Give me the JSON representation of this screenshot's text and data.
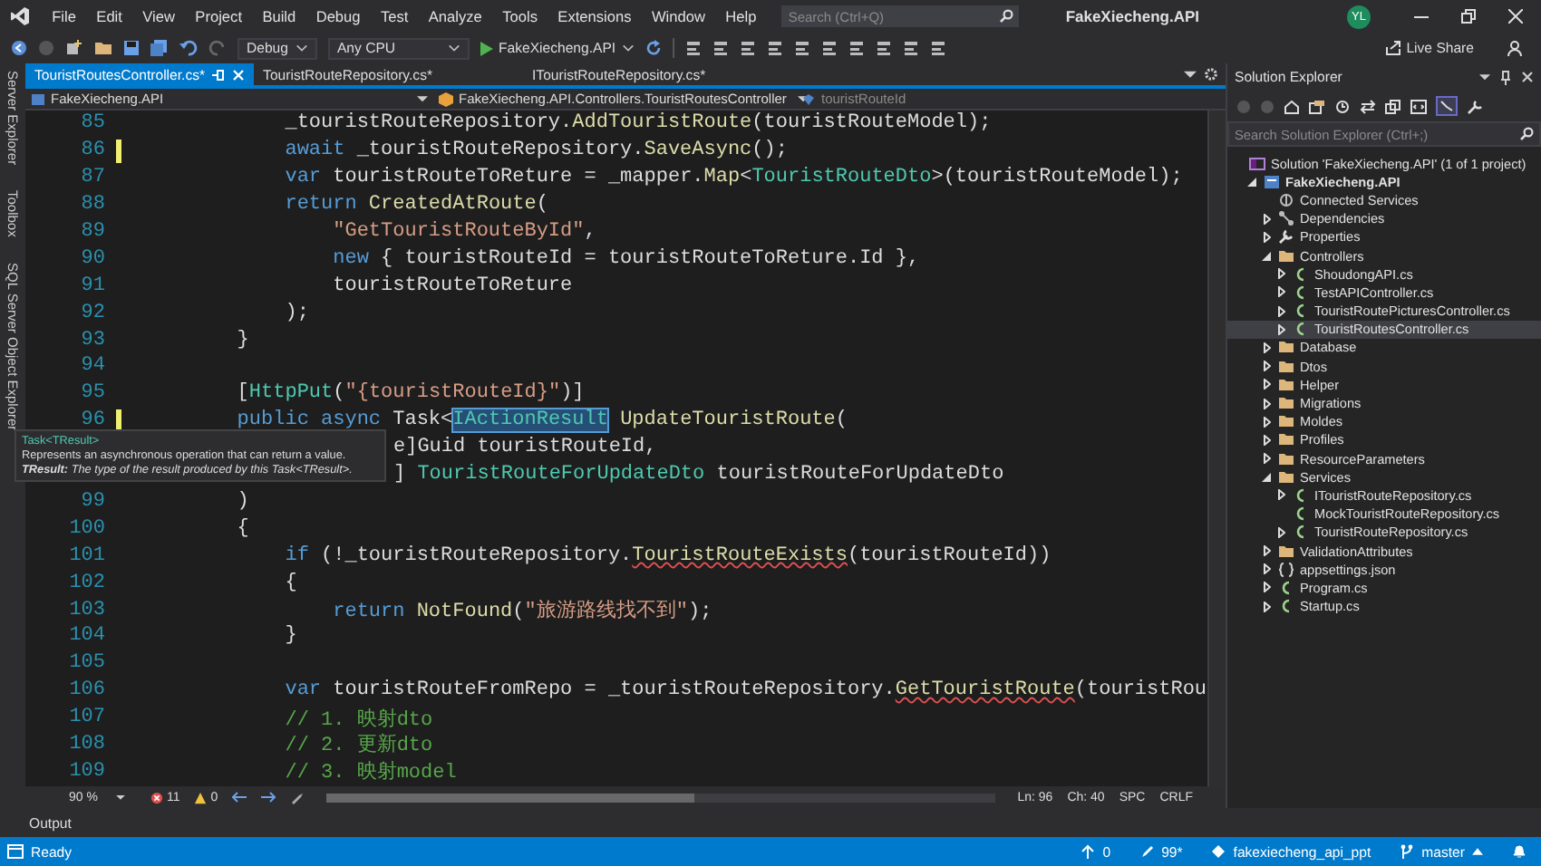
{
  "title_bar": {
    "menus": [
      "File",
      "Edit",
      "View",
      "Project",
      "Build",
      "Debug",
      "Test",
      "Analyze",
      "Tools",
      "Extensions",
      "Window",
      "Help"
    ],
    "search": {
      "placeholder": "Search (Ctrl+Q)"
    },
    "title": "FakeXiecheng.API",
    "avatar": "YL"
  },
  "toolbar": {
    "configuration": "Debug",
    "platform": "Any CPU",
    "run_target": "FakeXiecheng.API",
    "live_share": "Live Share"
  },
  "side_tabs": [
    "Server Explorer",
    "Toolbox",
    "SQL Server Object Explorer"
  ],
  "editor": {
    "tabs": [
      {
        "label": "TouristRoutesController.cs*",
        "selected": true
      },
      {
        "label": "TouristRouteRepository.cs*",
        "selected": false
      },
      {
        "label": "ITouristRouteRepository.cs*",
        "selected": false
      }
    ],
    "nav": {
      "project": "FakeXiecheng.API",
      "type": "FakeXiecheng.API.Controllers.TouristRoutesController",
      "member": "touristRouteId"
    },
    "lines": [
      {
        "number": "85",
        "changed": false,
        "tokens": [
          {
            "kind": "plain",
            "text": "            _touristRouteRepository."
          },
          {
            "kind": "method",
            "text": "AddTouristRoute"
          },
          {
            "kind": "plain",
            "text": "(touristRouteModel);"
          }
        ]
      },
      {
        "number": "86",
        "changed": true,
        "tokens": [
          {
            "kind": "kw",
            "text": "            await"
          },
          {
            "kind": "plain",
            "text": " _touristRouteRepository."
          },
          {
            "kind": "method",
            "text": "SaveAsync"
          },
          {
            "kind": "plain",
            "text": "();"
          }
        ]
      },
      {
        "number": "87",
        "changed": false,
        "tokens": [
          {
            "kind": "kw",
            "text": "            var"
          },
          {
            "kind": "plain",
            "text": " touristRouteToReture = _mapper."
          },
          {
            "kind": "method",
            "text": "Map"
          },
          {
            "kind": "plain",
            "text": "<"
          },
          {
            "kind": "type",
            "text": "TouristRouteDto"
          },
          {
            "kind": "plain",
            "text": ">(touristRouteModel);"
          }
        ]
      },
      {
        "number": "88",
        "changed": false,
        "tokens": [
          {
            "kind": "kw",
            "text": "            return"
          },
          {
            "kind": "method",
            "text": " CreatedAtRoute"
          },
          {
            "kind": "plain",
            "text": "("
          }
        ]
      },
      {
        "number": "89",
        "changed": false,
        "tokens": [
          {
            "kind": "str",
            "text": "                \"GetTouristRouteById\""
          },
          {
            "kind": "plain",
            "text": ","
          }
        ]
      },
      {
        "number": "90",
        "changed": false,
        "tokens": [
          {
            "kind": "kw",
            "text": "                new"
          },
          {
            "kind": "plain",
            "text": " { touristRouteId = touristRouteToReture.Id },"
          }
        ]
      },
      {
        "number": "91",
        "changed": false,
        "tokens": [
          {
            "kind": "plain",
            "text": "                touristRouteToReture"
          }
        ]
      },
      {
        "number": "92",
        "changed": false,
        "tokens": [
          {
            "kind": "plain",
            "text": "            );"
          }
        ]
      },
      {
        "number": "93",
        "changed": false,
        "tokens": [
          {
            "kind": "plain",
            "text": "        }"
          }
        ]
      },
      {
        "number": "94",
        "changed": false
      },
      {
        "number": "95",
        "changed": false,
        "tokens": [
          {
            "kind": "plain",
            "text": "        ["
          },
          {
            "kind": "type",
            "text": "HttpPut"
          },
          {
            "kind": "plain",
            "text": "("
          },
          {
            "kind": "str",
            "text": "\"{touristRouteId}\""
          },
          {
            "kind": "plain",
            "text": ")]"
          }
        ]
      },
      {
        "number": "96",
        "changed": true,
        "tokens": [
          {
            "kind": "kw",
            "text": "        public async"
          },
          {
            "kind": "plain",
            "text": " Task<"
          },
          {
            "kind": "selected-type",
            "text": "IActionResult"
          },
          {
            "kind": "method",
            "text": " UpdateTouristRoute"
          },
          {
            "kind": "plain",
            "text": "("
          }
        ]
      },
      {
        "tokens": [
          {
            "kind": "plain",
            "text": "e]Guid touristRouteId,"
          }
        ]
      },
      {
        "tokens": [
          {
            "kind": "plain",
            "text": "] "
          },
          {
            "kind": "type",
            "text": "TouristRouteForUpdateDto"
          },
          {
            "kind": "plain",
            "text": " touristRouteForUpdateDto"
          }
        ]
      },
      {
        "number": "99",
        "changed": false,
        "tokens": [
          {
            "kind": "plain",
            "text": "        )"
          }
        ]
      },
      {
        "number": "100",
        "changed": false,
        "tokens": [
          {
            "kind": "plain",
            "text": "        {"
          }
        ]
      },
      {
        "number": "101",
        "changed": false,
        "tokens": [
          {
            "kind": "kw",
            "text": "            if"
          },
          {
            "kind": "plain",
            "text": " (!_touristRouteRepository."
          },
          {
            "kind": "error-method",
            "text": "TouristRouteExists"
          },
          {
            "kind": "plain",
            "text": "(touristRouteId))"
          }
        ]
      },
      {
        "number": "102",
        "changed": false,
        "tokens": [
          {
            "kind": "plain",
            "text": "            {"
          }
        ]
      },
      {
        "number": "103",
        "changed": false,
        "tokens": [
          {
            "kind": "kw",
            "text": "                return"
          },
          {
            "kind": "method",
            "text": " NotFound"
          },
          {
            "kind": "plain",
            "text": "("
          },
          {
            "kind": "str",
            "text": "\"旅游路线找不到\""
          },
          {
            "kind": "plain",
            "text": ");"
          }
        ]
      },
      {
        "number": "104",
        "changed": false,
        "tokens": [
          {
            "kind": "plain",
            "text": "            }"
          }
        ]
      },
      {
        "number": "105",
        "changed": false
      },
      {
        "number": "106",
        "changed": false,
        "tokens": [
          {
            "kind": "kw",
            "text": "            var"
          },
          {
            "kind": "plain",
            "text": " touristRouteFromRepo = _touristRouteRepository."
          },
          {
            "kind": "error-method",
            "text": "GetTouristRoute"
          },
          {
            "kind": "plain",
            "text": "(touristRou"
          }
        ]
      },
      {
        "number": "107",
        "changed": false,
        "tokens": [
          {
            "kind": "comment",
            "text": "            // 1. 映射dto"
          }
        ]
      },
      {
        "number": "108",
        "changed": false,
        "tokens": [
          {
            "kind": "comment",
            "text": "            // 2. 更新dto"
          }
        ]
      },
      {
        "number": "109",
        "changed": false,
        "tokens": [
          {
            "kind": "comment",
            "text": "            // 3. 映射model"
          }
        ]
      }
    ],
    "tooltip": {
      "title": "Task<TResult>",
      "summary": "Represents an asynchronous operation that can return a value.",
      "param": "**TResult:** The type of the result produced by this Task<TResult>."
    },
    "status": {
      "zoom": "90 %",
      "errors": "11",
      "warnings": "0",
      "line": "Ln: 96",
      "column": "Ch: 40",
      "whitespace": "SPC",
      "line_ending": "CRLF"
    }
  },
  "solution_explorer": {
    "title": "Solution Explorer",
    "search": {
      "placeholder": "Search Solution Explorer (Ctrl+;)"
    },
    "tree": [
      {
        "label": "Solution 'FakeXiecheng.API' (1 of 1 project)",
        "kind": "solution",
        "selected": false,
        "children": [
          {
            "label": "FakeXiecheng.API",
            "kind": "project",
            "expanded": true,
            "selected": false,
            "children": [
              {
                "label": "Connected Services",
                "kind": "service",
                "selected": false
              },
              {
                "label": "Dependencies",
                "kind": "dependencies",
                "expanded": false,
                "selected": false
              },
              {
                "label": "Properties",
                "kind": "properties",
                "expanded": false,
                "selected": false
              },
              {
                "label": "Controllers",
                "kind": "folder",
                "expanded": true,
                "selected": false,
                "children": [
                  {
                    "label": "ShoudongAPI.cs",
                    "kind": "csharp",
                    "expanded": false,
                    "selected": false
                  },
                  {
                    "label": "TestAPIController.cs",
                    "kind": "csharp",
                    "expanded": false,
                    "selected": false
                  },
                  {
                    "label": "TouristRoutePicturesController.cs",
                    "kind": "csharp",
                    "expanded": false,
                    "selected": false
                  },
                  {
                    "label": "TouristRoutesController.cs",
                    "kind": "csharp",
                    "expanded": false,
                    "selected": true
                  }
                ]
              },
              {
                "label": "Database",
                "kind": "folder",
                "expanded": false,
                "selected": false
              },
              {
                "label": "Dtos",
                "kind": "folder",
                "expanded": false,
                "selected": false
              },
              {
                "label": "Helper",
                "kind": "folder",
                "expanded": false,
                "selected": false
              },
              {
                "label": "Migrations",
                "kind": "folder",
                "expanded": false,
                "selected": false
              },
              {
                "label": "Moldes",
                "kind": "folder",
                "expanded": false,
                "selected": false
              },
              {
                "label": "Profiles",
                "kind": "folder",
                "expanded": false,
                "selected": false
              },
              {
                "label": "ResourceParameters",
                "kind": "folder",
                "expanded": false,
                "selected": false
              },
              {
                "label": "Services",
                "kind": "folder",
                "expanded": true,
                "selected": false,
                "children": [
                  {
                    "label": "ITouristRouteRepository.cs",
                    "kind": "csharp",
                    "expanded": false,
                    "selected": false
                  },
                  {
                    "label": "MockTouristRouteRepository.cs",
                    "kind": "csharp",
                    "selected": false
                  },
                  {
                    "label": "TouristRouteRepository.cs",
                    "kind": "csharp",
                    "expanded": false,
                    "selected": false
                  }
                ]
              },
              {
                "label": "ValidationAttributes",
                "kind": "folder",
                "expanded": false,
                "selected": false
              },
              {
                "label": "appsettings.json",
                "kind": "json",
                "expanded": false,
                "selected": false
              },
              {
                "label": "Program.cs",
                "kind": "csharp",
                "expanded": false,
                "selected": false
              },
              {
                "label": "Startup.cs",
                "kind": "csharp",
                "expanded": false,
                "selected": false
              }
            ]
          }
        ]
      }
    ]
  },
  "output_tab": "Output",
  "status_bar": {
    "state": "Ready",
    "pending": "0",
    "changes": "99*",
    "repository": "fakexiecheng_api_ppt",
    "branch": "master"
  }
}
